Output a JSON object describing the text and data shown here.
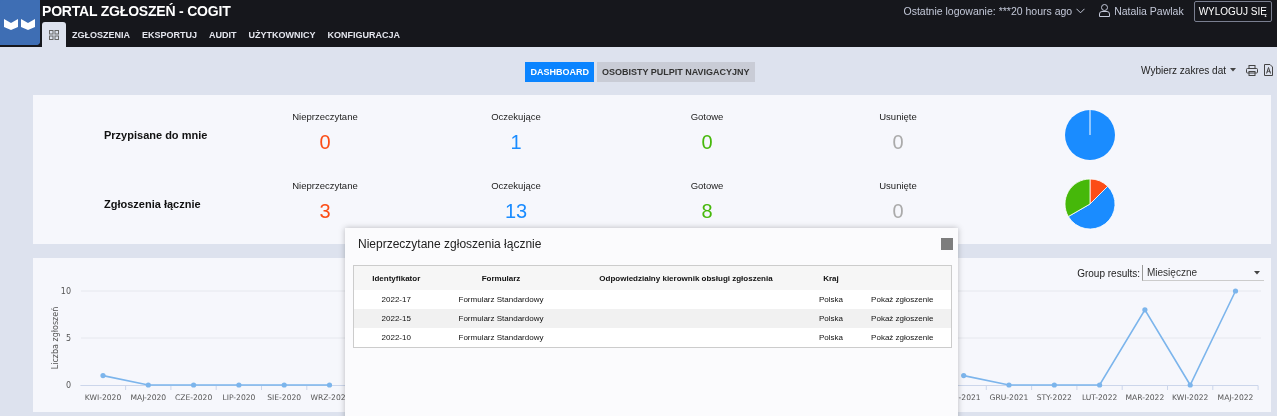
{
  "header": {
    "title": "PORTAL ZGŁOSZEŃ - COGIT",
    "last_login": "Ostatnie logowanie: ***20 hours ago",
    "user": "Natalia Pawlak",
    "logout": "WYLOGUJ SIĘ"
  },
  "nav": [
    {
      "kind": "icon",
      "selected": true
    },
    {
      "kind": "text",
      "label": "ZGŁOSZENIA",
      "selected": false
    },
    {
      "kind": "text",
      "label": "EKSPORTUJ",
      "selected": false
    },
    {
      "kind": "text",
      "label": "AUDIT",
      "selected": false
    },
    {
      "kind": "text",
      "label": "UŻYTKOWNICY",
      "selected": false
    },
    {
      "kind": "text",
      "label": "KONFIGURACJA",
      "selected": false
    }
  ],
  "views": [
    {
      "label": "DASHBOARD",
      "selected": true
    },
    {
      "label": "OSOBISTY PULPIT NAVIGACYJNY",
      "selected": false
    }
  ],
  "date_range": "Wybierz zakres dat",
  "summary": [
    {
      "label": "Przypisane do mnie",
      "stats": [
        {
          "label": "Nieprzeczytane",
          "value": "0",
          "color": "#fc4d16"
        },
        {
          "label": "Oczekujące",
          "value": "1",
          "color": "#1a8cff"
        },
        {
          "label": "Gotowe",
          "value": "0",
          "color": "#46b80a"
        },
        {
          "label": "Usunięte",
          "value": "0",
          "color": "#aaaaaa"
        }
      ]
    },
    {
      "label": "Zgłoszenia łącznie",
      "stats": [
        {
          "label": "Nieprzeczytane",
          "value": "3",
          "color": "#fc4d16"
        },
        {
          "label": "Oczekujące",
          "value": "13",
          "color": "#1a8cff"
        },
        {
          "label": "Gotowe",
          "value": "8",
          "color": "#46b80a"
        },
        {
          "label": "Usunięte",
          "value": "0",
          "color": "#aaaaaa"
        }
      ]
    }
  ],
  "chart": {
    "group_label": "Group results:",
    "group_value": "Miesięczne",
    "chart_data": {
      "type": "line",
      "ylabel": "Liczba zgłoszeń",
      "categories": [
        "KWI-2020",
        "MAJ-2020",
        "CZE-2020",
        "LIP-2020",
        "SIE-2020",
        "WRZ-202",
        null,
        null,
        null,
        null,
        null,
        null,
        null,
        null,
        null,
        null,
        null,
        null,
        null,
        "-2021",
        "GRU-2021",
        "STY-2022",
        "LUT-2022",
        "MAR-2022",
        "KWI-2022",
        "MAJ-2022"
      ],
      "series": [
        {
          "color": "#7cb5ec",
          "values": [
            1,
            0,
            0,
            0,
            0,
            0,
            null,
            null,
            null,
            null,
            null,
            null,
            null,
            null,
            null,
            null,
            null,
            null,
            null,
            1,
            0,
            0,
            0,
            8,
            0,
            10
          ]
        }
      ],
      "ylim": [
        0,
        10
      ],
      "yticks": [
        0,
        5,
        10
      ]
    }
  },
  "modal": {
    "title": "Nieprzeczytane zgłoszenia łącznie",
    "columns": [
      "Identyfikator",
      "Formularz",
      "Odpowiedzialny kierownik obsługi zgłoszenia",
      "Kraj"
    ],
    "rows": [
      {
        "id": "2022-17",
        "form": "Formularz Standardowy",
        "country": "Polska",
        "action": "Pokaż zgłoszenie"
      },
      {
        "id": "2022-15",
        "form": "Formularz Standardowy",
        "country": "Polska",
        "action": "Pokaż zgłoszenie"
      },
      {
        "id": "2022-10",
        "form": "Formularz Standardowy",
        "country": "Polska",
        "action": "Pokaż zgłoszenie"
      }
    ]
  }
}
